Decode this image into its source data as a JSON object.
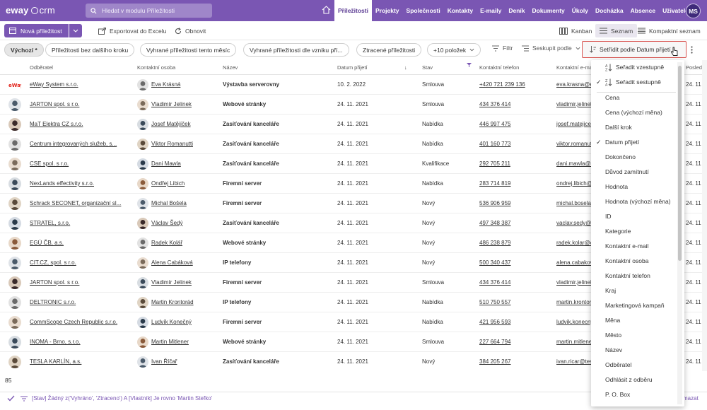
{
  "topbar": {
    "logo_eway": "eway",
    "logo_crm": "crm",
    "search_placeholder": "Hledat v modulu Příležitosti",
    "nav": [
      "Příležitosti",
      "Projekty",
      "Společnosti",
      "Kontakty",
      "E-maily",
      "Deník",
      "Dokumenty",
      "Úkoly",
      "Docházka",
      "Absence",
      "Uživatelé"
    ],
    "active_nav": "Příležitosti",
    "user_initials": "MS"
  },
  "toolbar": {
    "new_label": "Nová příležitost",
    "export_label": "Exportovat do Excelu",
    "refresh_label": "Obnovit",
    "kanban_label": "Kanban",
    "list_label": "Seznam",
    "compact_label": "Kompaktní seznam"
  },
  "filters": {
    "pills": [
      "Výchozí *",
      "Příležitosti bez dalšího kroku",
      "Vyhrané příležitosti tento měsíc",
      "Vyhrané příležitosti dle vzniku pří...",
      "Ztracené příležitosti",
      "+10 položek"
    ],
    "filter_label": "Filtr",
    "group_label": "Seskupit podle",
    "sort_label": "Setřídit podle Datum přijetí..."
  },
  "table": {
    "headers": [
      "Odběratel",
      "Kontaktní osoba",
      "Název",
      "Datum přijetí",
      "Stav",
      "Kontaktní telefon",
      "Kontaktní e-mail",
      "Posledn"
    ],
    "rows": [
      {
        "company": "eWay System s.r.o.",
        "contact": "Eva Krásná",
        "name": "Výstavba serverovny",
        "date": "10. 2. 2022",
        "state": "Smlouva",
        "phone": "+420 721 239 136",
        "email": "eva.krasna@eway-crm.c",
        "last": "24. 11."
      },
      {
        "company": "JARTON spol. s r.o.",
        "contact": "Vladimír Jelínek",
        "name": "Webové stránky",
        "date": "24. 11. 2021",
        "state": "Smlouva",
        "phone": "434 376 414",
        "email": "vladimir.jelinek@jarton",
        "last": "24. 11."
      },
      {
        "company": "MaT Elektra CZ s.r.o.",
        "contact": "Josef Matějíček",
        "name": "Zasíťování kanceláře",
        "date": "24. 11. 2021",
        "state": "Nabídka",
        "phone": "446 997 475",
        "email": "josef.matejicek@mat.cz",
        "last": "24. 11."
      },
      {
        "company": "Centrum integrovaných služeb, s...",
        "contact": "Viktor Romanutti",
        "name": "Zasíťování kanceláře",
        "date": "24. 11. 2021",
        "state": "Nabídka",
        "phone": "401 160 773",
        "email": "viktor.romanutti@cis.cz",
        "last": "24. 11."
      },
      {
        "company": "CSE spol. s r.o.",
        "contact": "Dani Mawla",
        "name": "Zasíťování kanceláře",
        "date": "24. 11. 2021",
        "state": "Kvalifikace",
        "phone": "292 705 211",
        "email": "dani.mawla@cse.cz",
        "last": "24. 11."
      },
      {
        "company": "NexLands effectivity s.r.o.",
        "contact": "Ondřej Libich",
        "name": "Firemní server",
        "date": "24. 11. 2021",
        "state": "Nabídka",
        "phone": "283 714 819",
        "email": "ondrej.libich@nexlands",
        "last": "24. 11."
      },
      {
        "company": "Schrack SECONET, organizační sl...",
        "contact": "Michal Bošela",
        "name": "Firemní server",
        "date": "24. 11. 2021",
        "state": "Nový",
        "phone": "536 906 959",
        "email": "michal.bosela@schrack",
        "last": "24. 11."
      },
      {
        "company": "STRATEL, s.r.o.",
        "contact": "Václav Šedý",
        "name": "Zasíťování kanceláře",
        "date": "24. 11. 2021",
        "state": "Nový",
        "phone": "497 348 387",
        "email": "vaclav.sedy@stratel.cz",
        "last": "24. 11."
      },
      {
        "company": "EGÚ ČB, a.s.",
        "contact": "Radek Kolář",
        "name": "Webové stránky",
        "date": "24. 11. 2021",
        "state": "Nový",
        "phone": "486 238 879",
        "email": "radek.kolar@egu.cz",
        "last": "24. 11."
      },
      {
        "company": "CIT.CZ, spol. s r.o.",
        "contact": "Alena Cabáková",
        "name": "IP telefony",
        "date": "24. 11. 2021",
        "state": "Nový",
        "phone": "500 340 437",
        "email": "alena.cabakova@cit.cz",
        "last": "24. 11."
      },
      {
        "company": "JARTON spol. s r.o.",
        "contact": "Vladimír Jelínek",
        "name": "Firemní server",
        "date": "24. 11. 2021",
        "state": "Smlouva",
        "phone": "434 376 414",
        "email": "vladimir.jelinek@jarton",
        "last": "24. 11."
      },
      {
        "company": "DELTRONIC s.r.o.",
        "contact": "Martin Krontorád",
        "name": "IP telefony",
        "date": "24. 11. 2021",
        "state": "Nabídka",
        "phone": "510 750 557",
        "email": "martin.krontorad@delt",
        "last": "24. 11."
      },
      {
        "company": "CommScope Czech Republic s.r.o.",
        "contact": "Ludvík Konečný",
        "name": "Firemní server",
        "date": "24. 11. 2021",
        "state": "Nabídka",
        "phone": "421 956 593",
        "email": "ludvik.konecny@comm",
        "last": "24. 11."
      },
      {
        "company": "INOMA - Brno, s.r.o.",
        "contact": "Martin Mitlener",
        "name": "Webové stránky",
        "date": "24. 11. 2021",
        "state": "Smlouva",
        "phone": "227 664 794",
        "email": "martin.mitlener@inoma",
        "last": "24. 11."
      },
      {
        "company": "TESLA KARLÍN, a.s.",
        "contact": "Ivan Říčař",
        "name": "Zasíťování kanceláře",
        "date": "24. 11. 2021",
        "state": "Nový",
        "phone": "384 205 267",
        "email": "ivan.ricar@tesla.cz",
        "last": "24. 11."
      }
    ],
    "count": "85"
  },
  "menu": {
    "sort_asc": "Seřadit vzestupně",
    "sort_desc": "Seřadit sestupně",
    "fields": [
      "Cena",
      "Cena (výchozí měna)",
      "Další krok",
      "Datum přijetí",
      "Dokončeno",
      "Důvod zamítnutí",
      "Hodnota",
      "Hodnota (výchozí měna)",
      "ID",
      "Kategorie",
      "Kontaktní e-mail",
      "Kontaktní osoba",
      "Kontaktní telefon",
      "Kraj",
      "Marketingová kampaň",
      "Měna",
      "Město",
      "Název",
      "Odběratel",
      "Odhlásit z odběru",
      "P. O. Box"
    ],
    "checked_field": "Datum přijetí"
  },
  "status": {
    "filter_text": "[Stav] Žádný z('Vyhráno', 'Ztraceno') A [Vlastník] Je rovno 'Martin Stefko'",
    "right_text": "mazat"
  },
  "colors": {
    "brand": "#7a56b3",
    "sort_outline": "#d9534f"
  }
}
